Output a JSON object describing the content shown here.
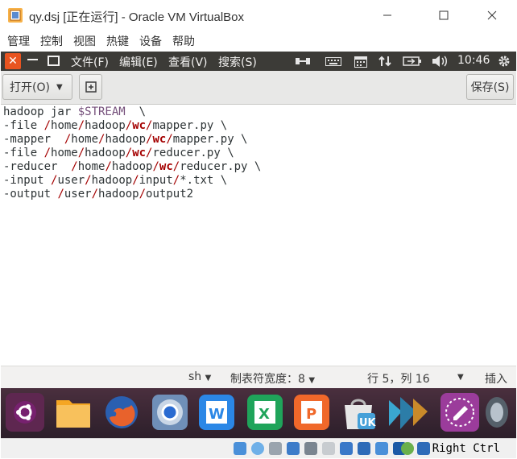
{
  "host_window": {
    "title": "qy.dsj [正在运行] - Oracle VM VirtualBox",
    "menu": [
      "管理",
      "控制",
      "视图",
      "热键",
      "设备",
      "帮助"
    ]
  },
  "guest_panel": {
    "menu": [
      "文件(F)",
      "编辑(E)",
      "查看(V)",
      "搜索(S)"
    ],
    "clock": "10:46"
  },
  "toolbar": {
    "open_label": "打开(O)",
    "save_label": "保存(S)"
  },
  "editor": {
    "lines": [
      "hadoop jar $STREAM  \\",
      "-file /home/hadoop/wc/mapper.py \\",
      "-mapper  /home/hadoop/wc/mapper.py \\",
      "-file /home/hadoop/wc/reducer.py \\",
      "-reducer  /home/hadoop/wc/reducer.py \\",
      "-input /user/hadoop/input/*.txt \\",
      "-output /user/hadoop/output2"
    ]
  },
  "statusbar": {
    "language": "sh",
    "tab_width": "制表符宽度：8",
    "position": "行 5，列 16",
    "mode": "插入"
  },
  "dock": {
    "items": [
      "ubuntu-logo",
      "files",
      "firefox",
      "chromium",
      "wps-writer",
      "wps-spreadsheets",
      "wps-presentation",
      "software-center",
      "app",
      "app",
      "app"
    ]
  },
  "vbox_status": {
    "host_key": "Right Ctrl"
  },
  "colors": {
    "ubuntu_orange": "#e95420",
    "panel_bg": "#3c3b37",
    "path_red": "#a40000",
    "variable_purple": "#75507b"
  }
}
